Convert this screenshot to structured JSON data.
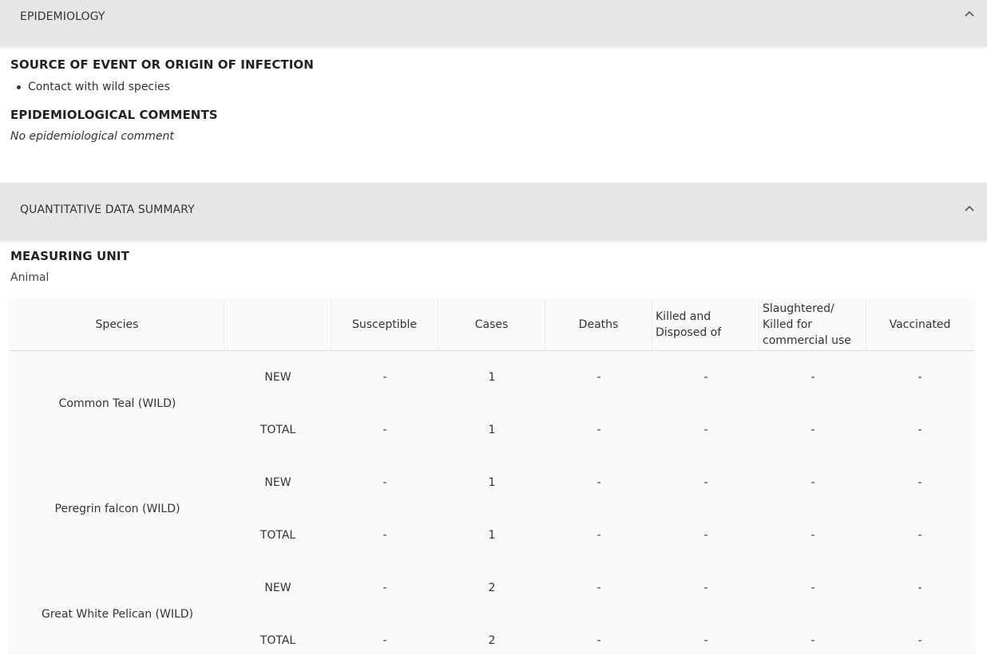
{
  "sections": {
    "epidemiology": {
      "title": "EPIDEMIOLOGY",
      "source_heading": "SOURCE OF EVENT OR ORIGIN OF INFECTION",
      "sources": [
        "Contact with wild species"
      ],
      "comments_heading": "EPIDEMIOLOGICAL COMMENTS",
      "comments_text": "No epidemiological comment"
    },
    "quantitative": {
      "title": "QUANTITATIVE DATA SUMMARY",
      "measuring_unit_heading": "MEASURING UNIT",
      "measuring_unit": "Animal"
    }
  },
  "icons": {
    "collapse": "chevron-up-icon"
  },
  "table": {
    "columns": {
      "species": "Species",
      "susceptible": "Susceptible",
      "cases": "Cases",
      "deaths": "Deaths",
      "killed": "Killed and Disposed of",
      "slaughtered": "Slaughtered/ Killed for commercial use",
      "vaccinated": "Vaccinated"
    },
    "species": [
      {
        "name": "Common Teal (WILD)",
        "rows": [
          {
            "type": "NEW",
            "susceptible": "-",
            "cases": "1",
            "deaths": "-",
            "killed": "-",
            "slaughtered": "-",
            "vaccinated": "-"
          },
          {
            "type": "TOTAL",
            "susceptible": "-",
            "cases": "1",
            "deaths": "-",
            "killed": "-",
            "slaughtered": "-",
            "vaccinated": "-"
          }
        ]
      },
      {
        "name": "Peregrin falcon (WILD)",
        "rows": [
          {
            "type": "NEW",
            "susceptible": "-",
            "cases": "1",
            "deaths": "-",
            "killed": "-",
            "slaughtered": "-",
            "vaccinated": "-"
          },
          {
            "type": "TOTAL",
            "susceptible": "-",
            "cases": "1",
            "deaths": "-",
            "killed": "-",
            "slaughtered": "-",
            "vaccinated": "-"
          }
        ]
      },
      {
        "name": "Great White Pelican (WILD)",
        "rows": [
          {
            "type": "NEW",
            "susceptible": "-",
            "cases": "2",
            "deaths": "-",
            "killed": "-",
            "slaughtered": "-",
            "vaccinated": "-"
          },
          {
            "type": "TOTAL",
            "susceptible": "-",
            "cases": "2",
            "deaths": "-",
            "killed": "-",
            "slaughtered": "-",
            "vaccinated": "-"
          }
        ]
      }
    ]
  }
}
